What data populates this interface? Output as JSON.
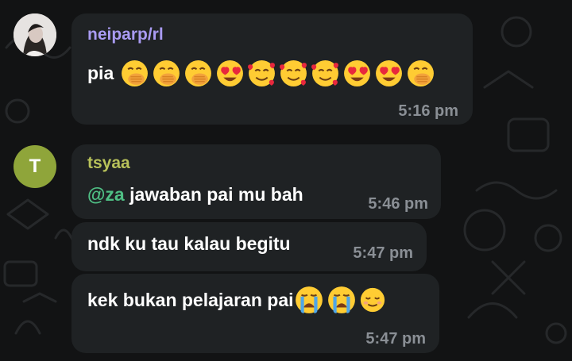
{
  "colors": {
    "background": "#121314",
    "bubble": "#1f2224",
    "sender_1": "#a99bf2",
    "sender_2": "#b8c25a",
    "mention": "#4fbf84",
    "timestamp": "#8a8f95",
    "avatar_letter_bg": "#8fa53a"
  },
  "messages": [
    {
      "sender": "neiparp/rl",
      "avatar": "profile-photo",
      "text": "pia",
      "emojis": [
        "hand-over-mouth-icon",
        "hand-over-mouth-icon",
        "hand-over-mouth-icon",
        "heart-eyes-icon",
        "smiling-face-with-hearts-icon",
        "smiling-face-with-hearts-icon",
        "smiling-face-with-hearts-icon",
        "heart-eyes-icon",
        "heart-eyes-icon",
        "hand-over-mouth-icon"
      ],
      "time": "5:16 pm"
    },
    {
      "sender": "tsyaa",
      "avatar_letter": "T",
      "mention": "@za",
      "text": " jawaban pai mu bah",
      "time": "5:46 pm"
    },
    {
      "text": "ndk ku tau kalau begitu",
      "time": "5:47 pm"
    },
    {
      "text": "kek bukan pelajaran pai",
      "emojis": [
        "crying-face-icon",
        "crying-face-icon",
        "relieved-face-icon"
      ],
      "time": "5:47 pm"
    }
  ]
}
